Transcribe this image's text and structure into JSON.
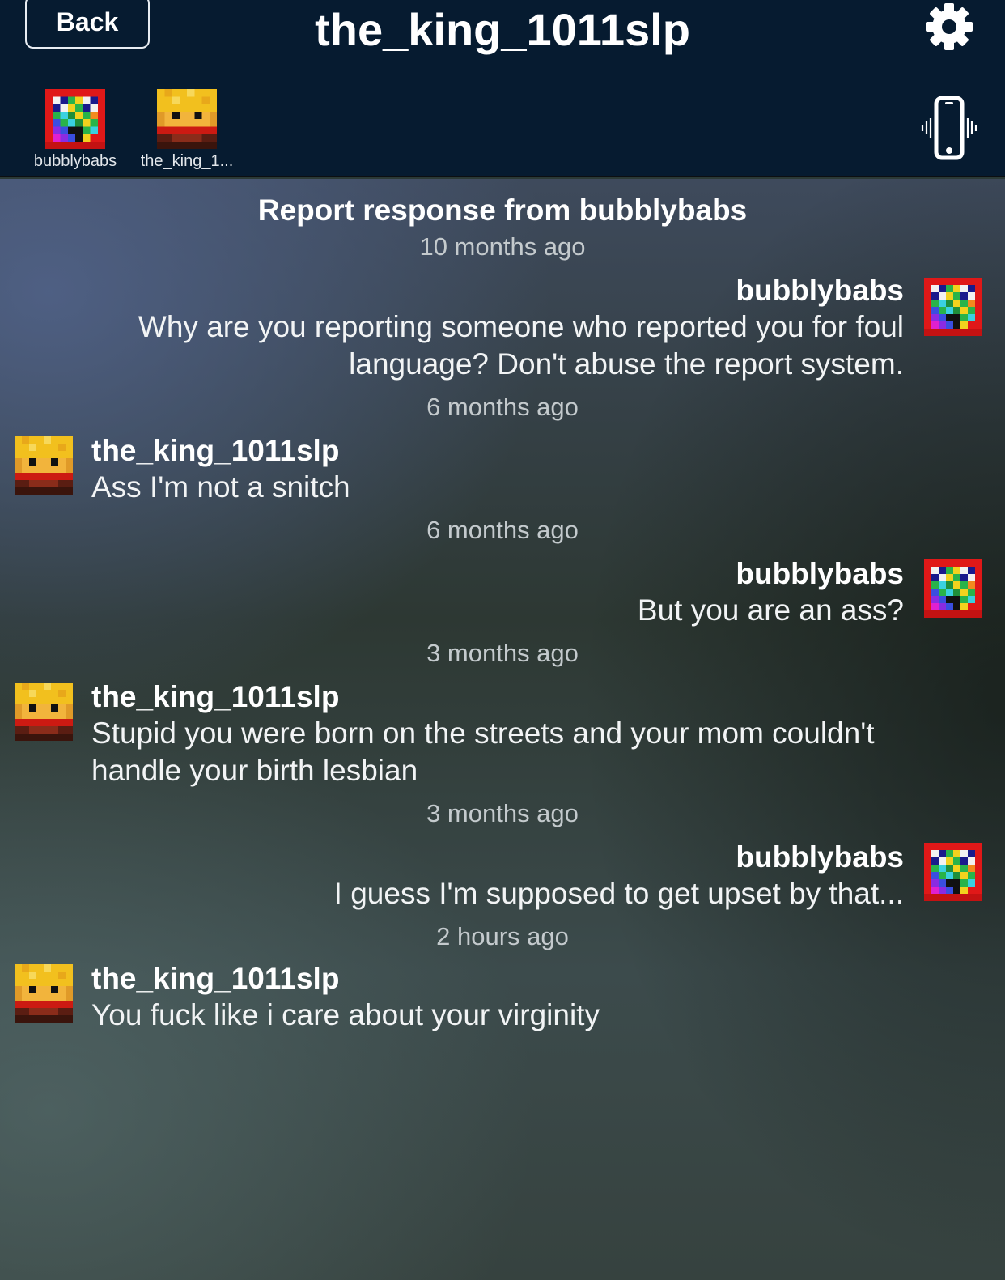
{
  "navbar": {
    "back_label": "Back",
    "title": "the_king_1011slp"
  },
  "participants": [
    {
      "name": "bubblybabs",
      "avatar": "rainbow-pixel-face"
    },
    {
      "name": "the_king_1...",
      "avatar": "blonde-pixel-face"
    }
  ],
  "icons": {
    "settings": "gear-icon",
    "vibrate": "vibrating-phone-icon"
  },
  "conversation": {
    "title": "Report response from bubblybabs",
    "items": [
      {
        "time": "10 months ago",
        "author": "bubblybabs",
        "side": "right",
        "lines": [
          "Why are you reporting someone who reported you for foul",
          "language?  Don't abuse the report system."
        ]
      },
      {
        "time": "6 months ago",
        "author": "the_king_1011slp",
        "side": "left",
        "lines": [
          "Ass I'm not a snitch"
        ]
      },
      {
        "time": "6 months ago",
        "author": "bubblybabs",
        "side": "right",
        "lines": [
          "But you are an ass?"
        ]
      },
      {
        "time": "3 months ago",
        "author": "the_king_1011slp",
        "side": "left",
        "lines": [
          "Stupid you were born on the streets and your mom couldn't",
          "handle your birth lesbian"
        ]
      },
      {
        "time": "3 months ago",
        "author": "bubblybabs",
        "side": "right",
        "lines": [
          "I guess I'm supposed to get upset by that..."
        ]
      },
      {
        "time": "2 hours ago",
        "author": "the_king_1011slp",
        "side": "left",
        "lines": [
          "You fuck like i care about your virginity"
        ]
      }
    ]
  },
  "colors": {
    "nav_background": "#061b30",
    "timestamp_text": "#c4cacd"
  }
}
